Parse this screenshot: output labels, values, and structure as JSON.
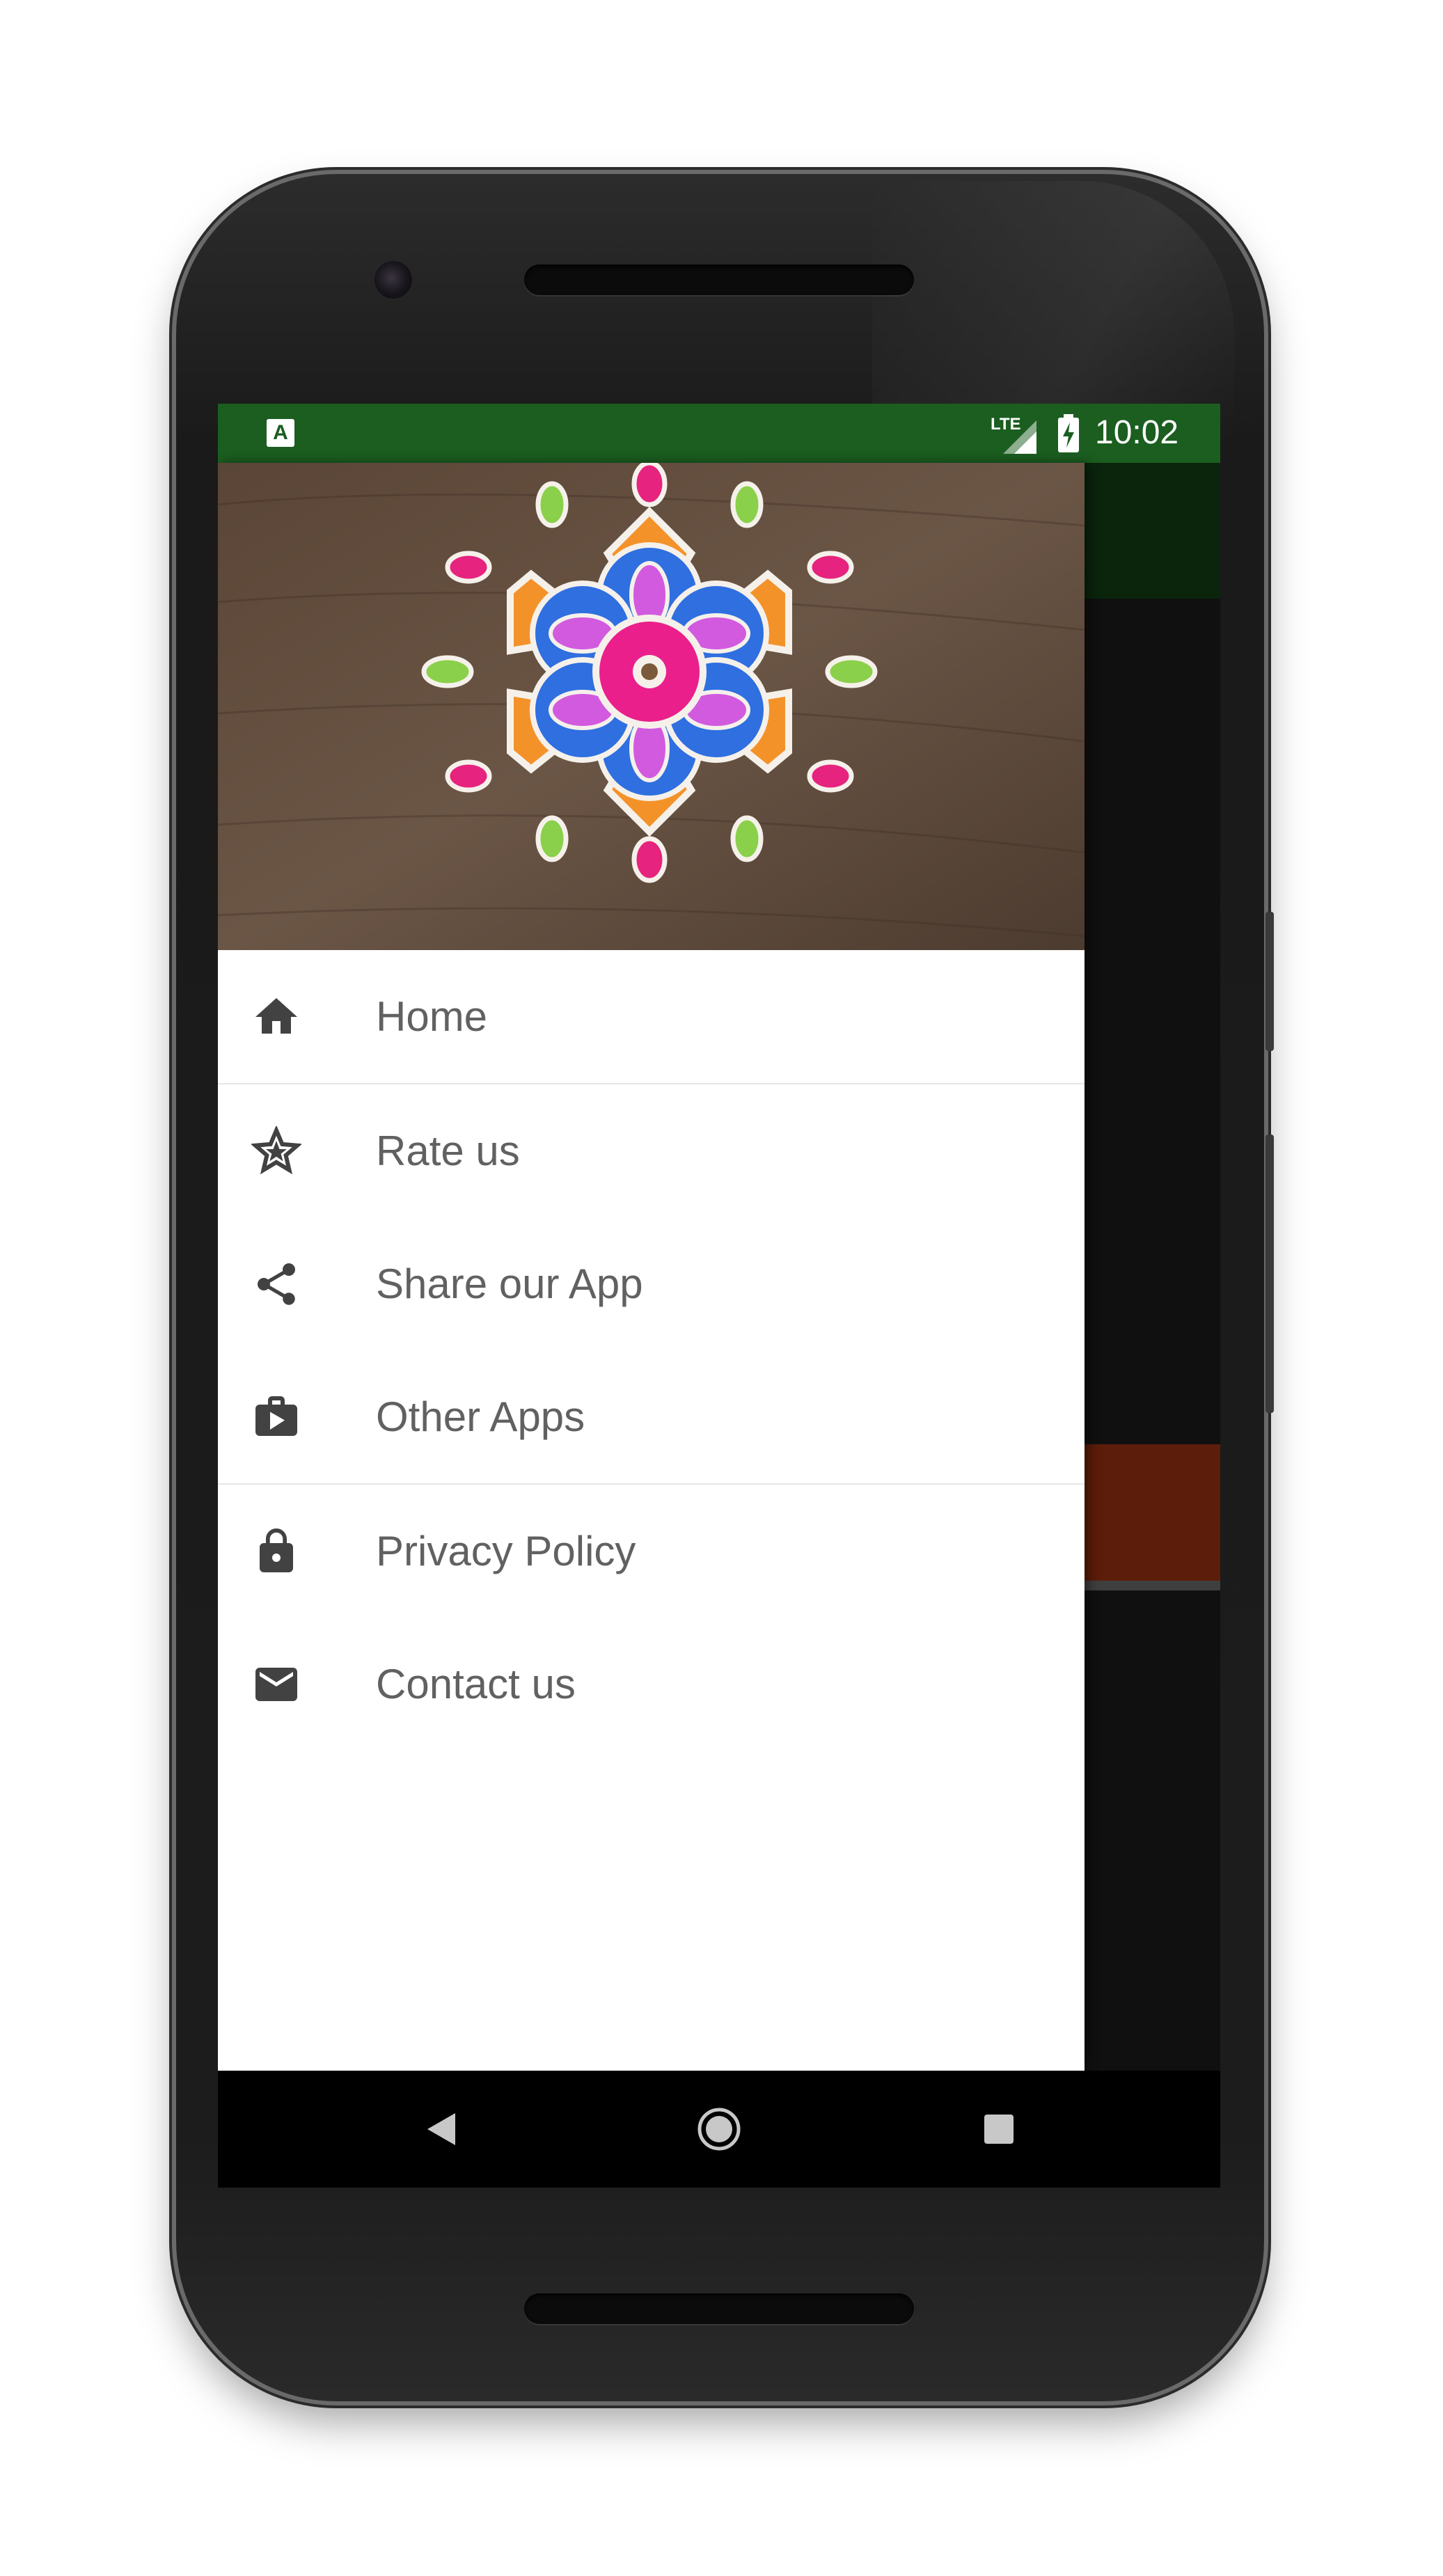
{
  "status_bar": {
    "app_icon_letter": "A",
    "network": "LTE",
    "time": "10:02",
    "color": "#1b5e20"
  },
  "drawer": {
    "header_image": "rangoli-flower-art",
    "menu_items": [
      {
        "label": "Home",
        "icon": "home-icon"
      },
      {
        "label": "Rate us",
        "icon": "star-icon"
      },
      {
        "label": "Share our App",
        "icon": "share-icon"
      },
      {
        "label": "Other Apps",
        "icon": "store-bag-icon"
      },
      {
        "label": "Privacy Policy",
        "icon": "lock-icon"
      },
      {
        "label": "Contact us",
        "icon": "mail-icon"
      }
    ]
  },
  "navigation_bar": {
    "buttons": [
      "back-icon",
      "home-circle-icon",
      "recents-icon"
    ]
  },
  "colors": {
    "primary_dark": "#1b5e20",
    "card_orange": "#e64a19",
    "card_magenta": "#880e4f",
    "menu_text": "#616161",
    "icon": "#424242"
  }
}
